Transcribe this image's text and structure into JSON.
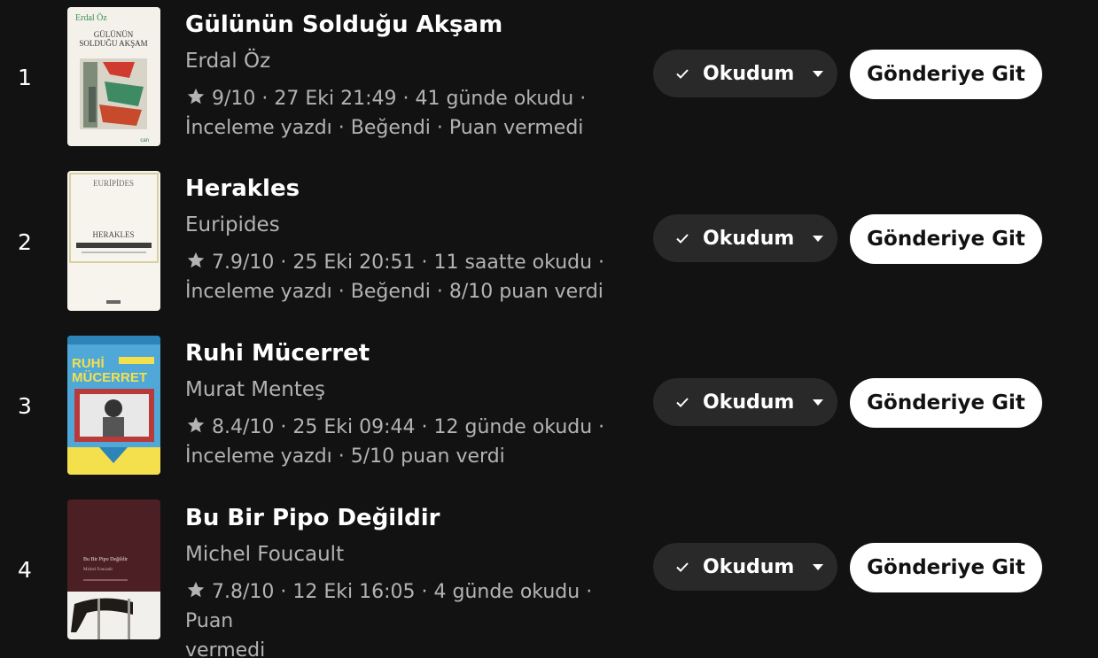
{
  "books": [
    {
      "rank": "1",
      "title": "Gülünün Solduğu Akşam",
      "author": "Erdal Öz",
      "meta_line1": "9/10 · 27 Eki 21:49 · 41 günde okudu ·",
      "meta_line2": "İnceleme yazdı · Beğendi · Puan vermedi",
      "status_label": "Okudum",
      "action_label": "Gönderiye Git",
      "cover_author": "Erdal Öz",
      "cover_title_1": "GÜLÜNÜN",
      "cover_title_2": "SOLDUĞU AKŞAM",
      "cover_publisher": "can"
    },
    {
      "rank": "2",
      "title": "Herakles",
      "author": "Euripides",
      "meta_line1": "7.9/10 · 25 Eki 20:51 · 11 saatte okudu ·",
      "meta_line2": "İnceleme yazdı · Beğendi · 8/10 puan verdi",
      "status_label": "Okudum",
      "action_label": "Gönderiye Git",
      "cover_author": "EURİPİDES",
      "cover_title": "HERAKLES"
    },
    {
      "rank": "3",
      "title": "Ruhi Mücerret",
      "author": "Murat Menteş",
      "meta_line1": "8.4/10 · 25 Eki 09:44 · 12 günde okudu ·",
      "meta_line2": "İnceleme yazdı · 5/10 puan verdi",
      "status_label": "Okudum",
      "action_label": "Gönderiye Git",
      "cover_title_1": "RUHİ",
      "cover_title_2": "MÜCERRET"
    },
    {
      "rank": "4",
      "title": "Bu Bir Pipo Değildir",
      "author": "Michel Foucault",
      "meta_line1": "7.8/10 · 12 Eki 16:05 · 4 günde okudu · Puan",
      "meta_line2": "vermedi",
      "status_label": "Okudum",
      "action_label": "Gönderiye Git",
      "cover_title": "Bu Bir Pipo Değildir",
      "cover_author": "Michel Foucault"
    }
  ],
  "colors": {
    "background": "#121212",
    "muted_text": "#b3b3b3",
    "status_button": "#292929",
    "action_button": "#ffffff"
  },
  "icons": {
    "rating": "star-icon",
    "status": "check-icon",
    "dropdown": "chevron-down-icon"
  }
}
